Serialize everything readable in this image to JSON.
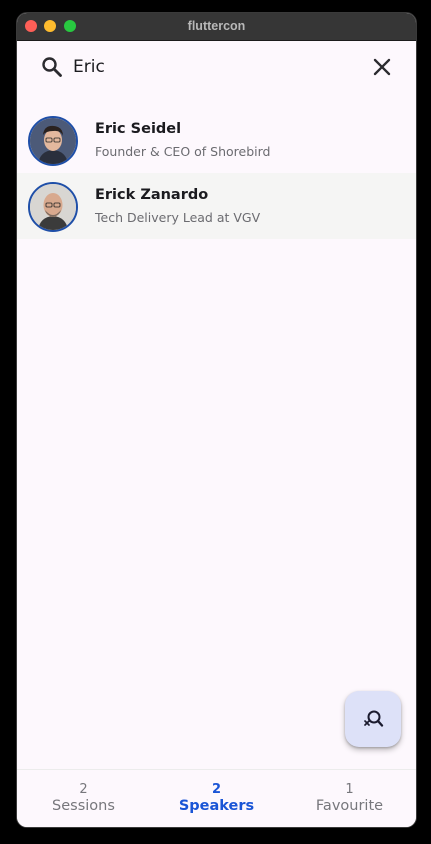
{
  "window": {
    "title": "fluttercon"
  },
  "search": {
    "query": "Eric"
  },
  "speakers": [
    {
      "name": "Eric Seidel",
      "title": "Founder & CEO of Shorebird"
    },
    {
      "name": "Erick Zanardo",
      "title": "Tech Delivery Lead at VGV"
    }
  ],
  "nav": [
    {
      "count": "2",
      "label": "Sessions"
    },
    {
      "count": "2",
      "label": "Speakers",
      "active": true
    },
    {
      "count": "1",
      "label": "Favourite"
    }
  ],
  "colors": {
    "accent": "#1a55d6",
    "fab_bg": "#dde1f8",
    "window_bg": "#fdf8fd"
  },
  "icons": {
    "search": "search-icon",
    "clear": "close-icon",
    "fab": "search-off-icon"
  }
}
